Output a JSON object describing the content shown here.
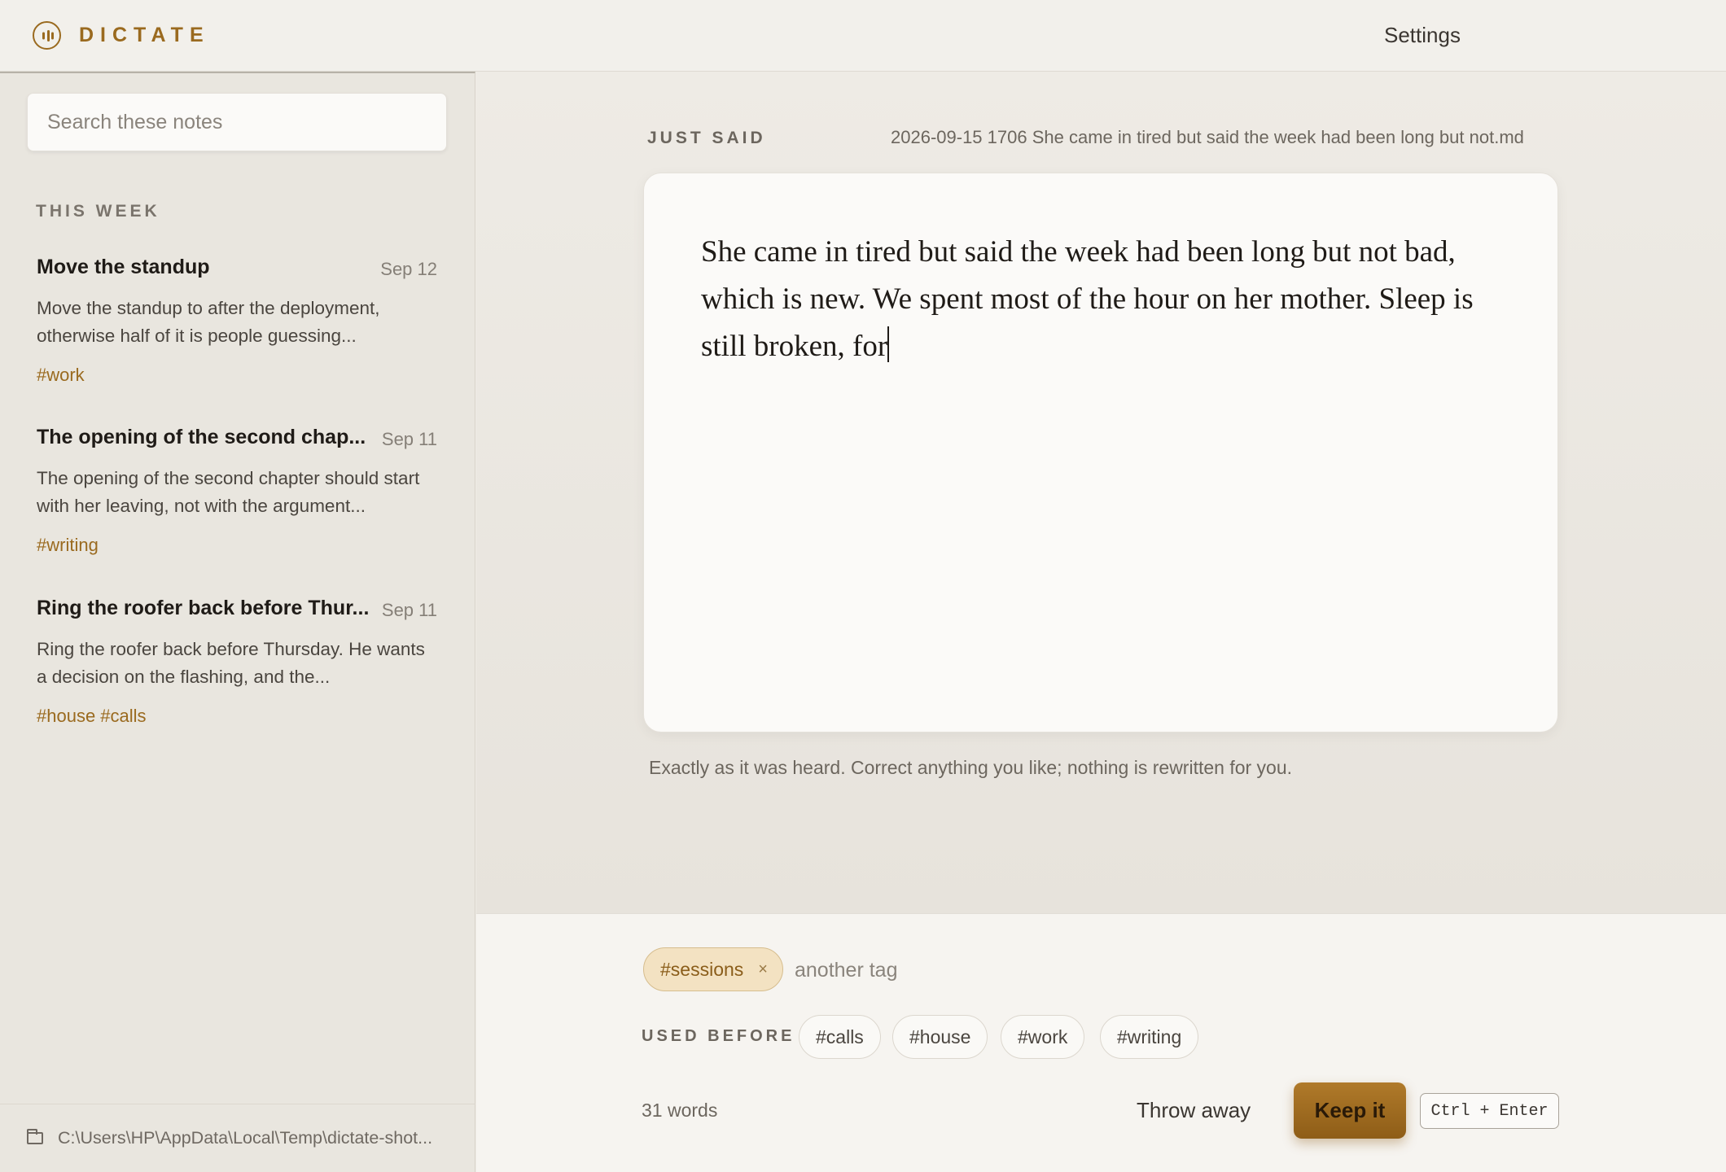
{
  "app": {
    "name": "DICTATE",
    "settings_label": "Settings"
  },
  "sidebar": {
    "search_placeholder": "Search these notes",
    "section_label": "THIS WEEK",
    "notes": [
      {
        "title": "Move the standup",
        "date": "Sep 12",
        "preview": "Move the standup to after the deployment, otherwise half of it is people guessing...",
        "tags": "#work"
      },
      {
        "title": "The opening of the second chap...",
        "date": "Sep 11",
        "preview": "The opening of the second chapter should start with her leaving, not with the argument...",
        "tags": "#writing"
      },
      {
        "title": "Ring the roofer back before Thur...",
        "date": "Sep 11",
        "preview": "Ring the roofer back before Thursday. He wants a decision on the flashing, and the...",
        "tags": "#house #calls"
      }
    ],
    "footer_path": "C:\\Users\\HP\\AppData\\Local\\Temp\\dictate-shot..."
  },
  "editor": {
    "label": "JUST SAID",
    "filename": "2026-09-15 1706 She came in tired but said the week had been long but not.md",
    "text": "She came in tired but said the week had been long but not bad, which is new. We spent most of the hour on her mother. Sleep is still broken, for",
    "hint": "Exactly as it was heard. Correct anything you like; nothing is rewritten for you."
  },
  "tags": {
    "current": "#sessions",
    "remove_symbol": "×",
    "input_placeholder": "another tag",
    "used_before_label": "USED BEFORE",
    "used_before": [
      "#calls",
      "#house",
      "#work",
      "#writing"
    ]
  },
  "footer": {
    "word_count": "31 words",
    "throw_label": "Throw away",
    "keep_label": "Keep it",
    "shortcut": "Ctrl + Enter"
  },
  "colors": {
    "accent": "#9a6a1f",
    "keep_button": "#a06d22",
    "tag_chip_bg": "#f3e2c2"
  }
}
